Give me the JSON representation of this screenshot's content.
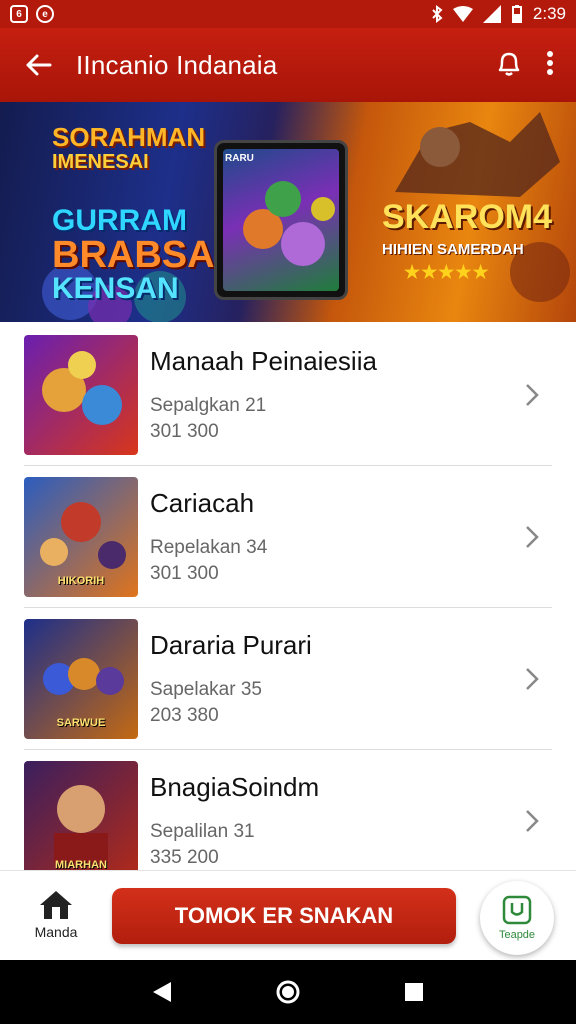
{
  "status_bar": {
    "time": "2:39",
    "left_icons": [
      "image-notification-icon",
      "app-notification-icon"
    ],
    "right_icons": [
      "bluetooth-icon",
      "wifi-icon",
      "signal-icon",
      "battery-icon"
    ]
  },
  "app_bar": {
    "title": "IIncanio Indanaia",
    "back_icon": "arrow-left-icon",
    "notification_icon": "bell-icon",
    "menu_icon": "more-vert-icon"
  },
  "banner": {
    "left_text": [
      "SORAHMAN",
      "IMENESAI",
      "GURRAM",
      "BRABSA",
      "KENSAN"
    ],
    "phone_label": "RARU",
    "right_title": "SKAROM4",
    "right_subtitle": "HIHIEN SAMERDAH",
    "stars": "★★★★★"
  },
  "list": {
    "items": [
      {
        "name": "Manaah  Peinaiesiia",
        "subtitle": "Sepalgkan 21",
        "numbers": "301  300",
        "thumb_label": "",
        "colors": [
          "#6a1fb0",
          "#d8361a"
        ]
      },
      {
        "name": "Cariacah",
        "subtitle": "Repelakan 34",
        "numbers": "301  300",
        "thumb_label": "HIKORIH",
        "colors": [
          "#2b5dbf",
          "#e0741c"
        ]
      },
      {
        "name": "Dararia Purari",
        "subtitle": "Sapelakar 35",
        "numbers": "203  380",
        "thumb_label": "SARWUE",
        "colors": [
          "#1d2f8a",
          "#c46a12"
        ]
      },
      {
        "name": "BnagiaSoindm",
        "subtitle": "Sepalilan 31",
        "numbers": "335  200",
        "thumb_label": "MIARHAN",
        "colors": [
          "#3a1f5e",
          "#b32a18"
        ]
      }
    ]
  },
  "bottom_bar": {
    "home_label": "Manda",
    "home_icon": "home-icon",
    "cta_label": "TOMOK ER SNAKAN",
    "fab_label": "Teapde",
    "fab_icon": "u-badge-icon"
  },
  "accent": "#c51f10"
}
